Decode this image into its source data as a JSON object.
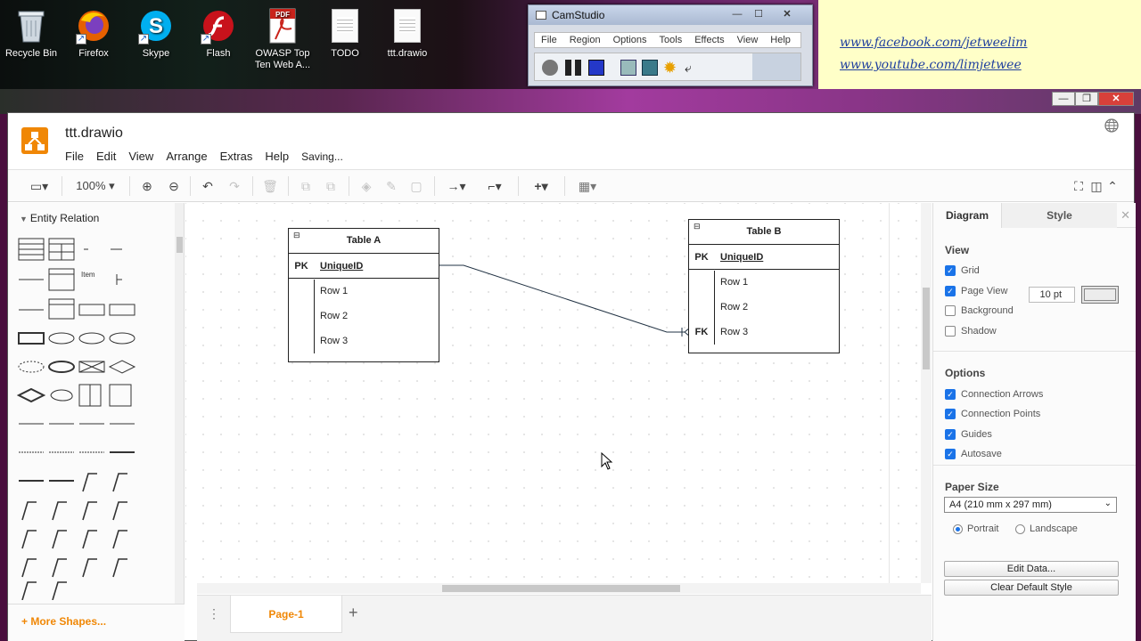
{
  "desktop": {
    "icons": [
      {
        "label": "Recycle Bin",
        "icon": "recycle-bin-icon"
      },
      {
        "label": "Firefox",
        "icon": "firefox-icon"
      },
      {
        "label": "Skype",
        "icon": "skype-icon"
      },
      {
        "label": "Flash",
        "icon": "flash-icon"
      },
      {
        "label": "OWASP Top Ten Web A...",
        "icon": "pdf-icon",
        "badge": "PDF"
      },
      {
        "label": "TODO",
        "icon": "text-file-icon"
      },
      {
        "label": "ttt.drawio",
        "icon": "drawio-file-icon"
      }
    ]
  },
  "camstudio": {
    "title": "CamStudio",
    "menu": [
      "File",
      "Region",
      "Options",
      "Tools",
      "Effects",
      "View",
      "Help"
    ]
  },
  "links": [
    "www.facebook.com/jetweelim",
    "www.youtube.com/limjetwee"
  ],
  "app": {
    "title": "ttt.drawio",
    "menu": [
      "File",
      "Edit",
      "View",
      "Arrange",
      "Extras",
      "Help"
    ],
    "status": "Saving...",
    "zoom": "100%"
  },
  "sidebar": {
    "section": "Entity Relation",
    "item_label": "Item",
    "more_shapes": "+ More Shapes..."
  },
  "diagram": {
    "table_a": {
      "title": "Table A",
      "pk_key": "PK",
      "pk_field": "UniqueID",
      "rows": [
        "Row 1",
        "Row 2",
        "Row 3"
      ]
    },
    "table_b": {
      "title": "Table B",
      "pk_key": "PK",
      "pk_field": "UniqueID",
      "rows": [
        "Row 1",
        "Row 2",
        "Row 3"
      ],
      "fk_key": "FK"
    }
  },
  "pages": {
    "tab": "Page-1"
  },
  "panel": {
    "tab_diagram": "Diagram",
    "tab_style": "Style",
    "view_title": "View",
    "grid_label": "Grid",
    "grid_size": "10 pt",
    "page_view_label": "Page View",
    "background_label": "Background",
    "shadow_label": "Shadow",
    "options_title": "Options",
    "connection_arrows_label": "Connection Arrows",
    "connection_points_label": "Connection Points",
    "guides_label": "Guides",
    "autosave_label": "Autosave",
    "paper_title": "Paper Size",
    "paper_value": "A4 (210 mm x 297 mm)",
    "portrait_label": "Portrait",
    "landscape_label": "Landscape",
    "edit_data_label": "Edit Data...",
    "clear_style_label": "Clear Default Style",
    "checks": {
      "grid": true,
      "page_view": true,
      "background": false,
      "shadow": false,
      "connection_arrows": true,
      "connection_points": true,
      "guides": true,
      "autosave": true
    },
    "orientation": "portrait"
  },
  "colors": {
    "accent": "#f08705",
    "checkbox": "#1a73e8"
  }
}
